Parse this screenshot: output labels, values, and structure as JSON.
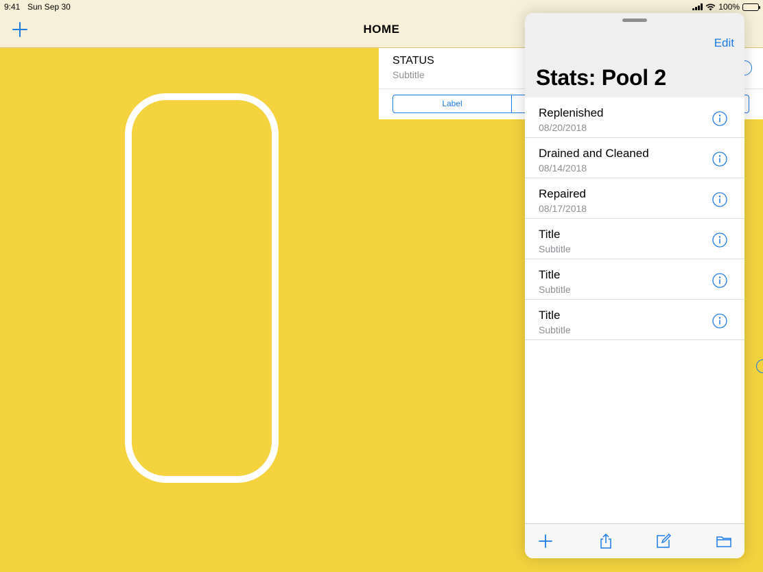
{
  "status_bar": {
    "time": "9:41",
    "date": "Sun Sep 30",
    "battery": "100%"
  },
  "navbar": {
    "title": "HOME",
    "add_icon": "plus-icon"
  },
  "status_card": {
    "title": "STATUS",
    "subtitle": "Subtitle",
    "segment_label": "Label"
  },
  "panel": {
    "title": "Stats: Pool 2",
    "edit_label": "Edit",
    "items": [
      {
        "title": "Replenished",
        "subtitle": "08/20/2018"
      },
      {
        "title": "Drained and Cleaned",
        "subtitle": "08/14/2018"
      },
      {
        "title": "Repaired",
        "subtitle": "08/17/2018"
      },
      {
        "title": "Title",
        "subtitle": "Subtitle"
      },
      {
        "title": "Title",
        "subtitle": "Subtitle"
      },
      {
        "title": "Title",
        "subtitle": "Subtitle"
      }
    ],
    "toolbar": [
      "plus-icon",
      "share-icon",
      "compose-icon",
      "folder-icon"
    ]
  },
  "colors": {
    "background": "#f4d33f",
    "accent": "#1a7ae8",
    "bar": "#f7f0d6"
  }
}
